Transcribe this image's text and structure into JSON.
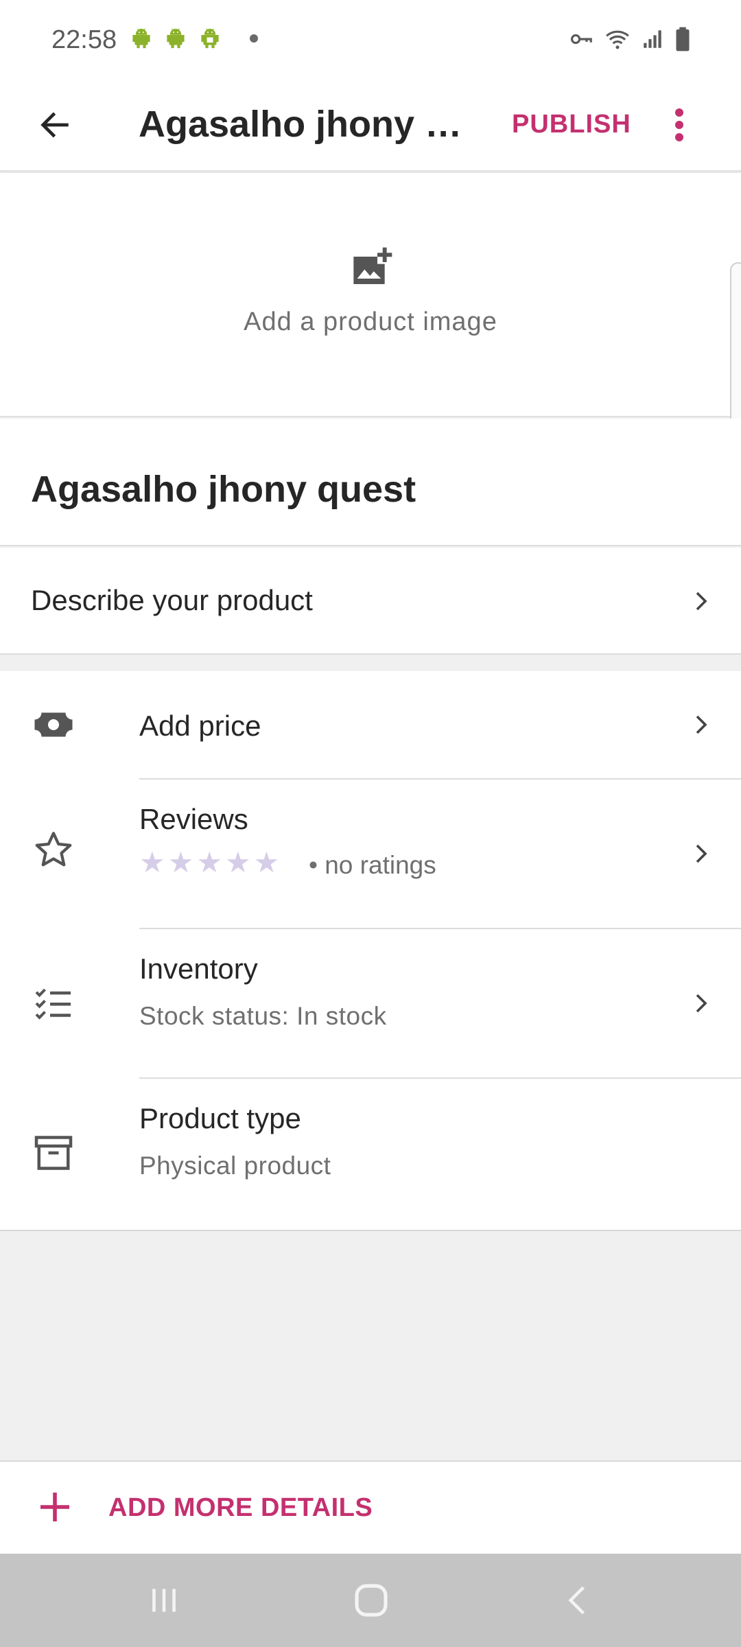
{
  "status_bar": {
    "time": "22:58"
  },
  "app_bar": {
    "title": "Agasalho jhony quest",
    "publish_label": "PUBLISH"
  },
  "image_section": {
    "label": "Add a product image"
  },
  "product": {
    "title": "Agasalho jhony quest",
    "describe_label": "Describe your product"
  },
  "details": {
    "price": {
      "title": "Add price",
      "icon": "cash-icon"
    },
    "reviews": {
      "title": "Reviews",
      "rating_stars": 0,
      "max_stars": 5,
      "ratings_text": "• no ratings",
      "icon": "star-outline-icon"
    },
    "inventory": {
      "title": "Inventory",
      "subtitle": "Stock status: In stock",
      "icon": "checklist-icon"
    },
    "product_type": {
      "title": "Product type",
      "subtitle": "Physical product",
      "icon": "archive-box-icon"
    }
  },
  "footer": {
    "add_more_label": "ADD MORE DETAILS"
  },
  "colors": {
    "accent": "#c4306f",
    "star_empty": "#d6cde8"
  }
}
